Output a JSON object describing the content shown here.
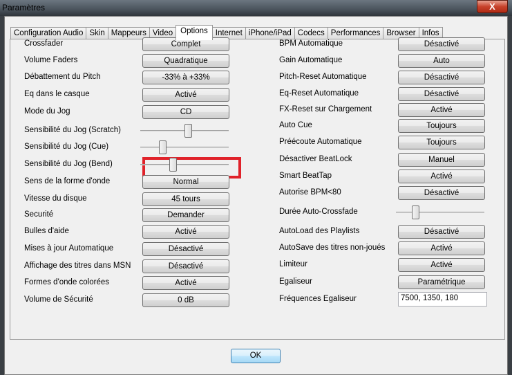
{
  "window": {
    "title": "Paramètres",
    "close_label": "X"
  },
  "tabs": [
    {
      "label": "Configuration Audio"
    },
    {
      "label": "Skin"
    },
    {
      "label": "Mappeurs"
    },
    {
      "label": "Video"
    },
    {
      "label": "Options",
      "active": true
    },
    {
      "label": "Internet"
    },
    {
      "label": "iPhone/iPad"
    },
    {
      "label": "Codecs"
    },
    {
      "label": "Performances"
    },
    {
      "label": "Browser"
    },
    {
      "label": "Infos"
    }
  ],
  "left": [
    {
      "label": "Crossfader",
      "type": "button",
      "value": "Complet"
    },
    {
      "label": "Volume Faders",
      "type": "button",
      "value": "Quadratique"
    },
    {
      "label": "Débattement du Pitch",
      "type": "button",
      "value": "-33% à +33%"
    },
    {
      "label": "Eq dans le casque",
      "type": "button",
      "value": "Activé"
    },
    {
      "label": "Mode du Jog",
      "type": "button",
      "value": "CD"
    },
    {
      "label": "Sensibilité du Jog (Scratch)",
      "type": "slider",
      "value": 0.55
    },
    {
      "label": "Sensibilité du Jog (Cue)",
      "type": "slider",
      "value": 0.23
    },
    {
      "label": "Sensibilité du Jog (Bend)",
      "type": "slider",
      "value": 0.36
    },
    {
      "label": "Sens de la forme d'onde",
      "type": "button",
      "value": "Normal"
    },
    {
      "label": "Vitesse du disque",
      "type": "button",
      "value": "45 tours"
    },
    {
      "label": "Securité",
      "type": "button",
      "value": "Demander"
    },
    {
      "label": "Bulles d'aide",
      "type": "button",
      "value": "Activé"
    },
    {
      "label": "Mises à jour Automatique",
      "type": "button",
      "value": "Désactivé"
    },
    {
      "label": "Affichage des titres dans MSN",
      "type": "button",
      "value": "Désactivé"
    },
    {
      "label": "Formes d'onde colorées",
      "type": "button",
      "value": "Activé"
    },
    {
      "label": "Volume de Sécurité",
      "type": "button",
      "value": "0 dB"
    }
  ],
  "right": [
    {
      "label": "BPM Automatique",
      "type": "button",
      "value": "Désactivé"
    },
    {
      "label": "Gain Automatique",
      "type": "button",
      "value": "Auto"
    },
    {
      "label": "Pitch-Reset Automatique",
      "type": "button",
      "value": "Désactivé"
    },
    {
      "label": "Eq-Reset Automatique",
      "type": "button",
      "value": "Désactivé"
    },
    {
      "label": "FX-Reset sur Chargement",
      "type": "button",
      "value": "Activé"
    },
    {
      "label": "Auto Cue",
      "type": "button",
      "value": "Toujours"
    },
    {
      "label": "Préécoute Automatique",
      "type": "button",
      "value": "Toujours"
    },
    {
      "label": "Désactiver BeatLock",
      "type": "button",
      "value": "Manuel"
    },
    {
      "label": "Smart BeatTap",
      "type": "button",
      "value": "Activé"
    },
    {
      "label": "Autorise BPM<80",
      "type": "button",
      "value": "Désactivé"
    },
    {
      "label": "Durée Auto-Crossfade",
      "type": "slider",
      "value": 0.2
    },
    {
      "label": "AutoLoad des Playlists",
      "type": "button",
      "value": "Désactivé"
    },
    {
      "label": "AutoSave des titres non-joués",
      "type": "button",
      "value": "Activé"
    },
    {
      "label": "Limiteur",
      "type": "button",
      "value": "Activé"
    },
    {
      "label": "Egaliseur",
      "type": "button",
      "value": "Paramétrique"
    },
    {
      "label": "Fréquences Egaliseur",
      "type": "input",
      "value": "7500, 1350, 180"
    }
  ],
  "ok_label": "OK"
}
